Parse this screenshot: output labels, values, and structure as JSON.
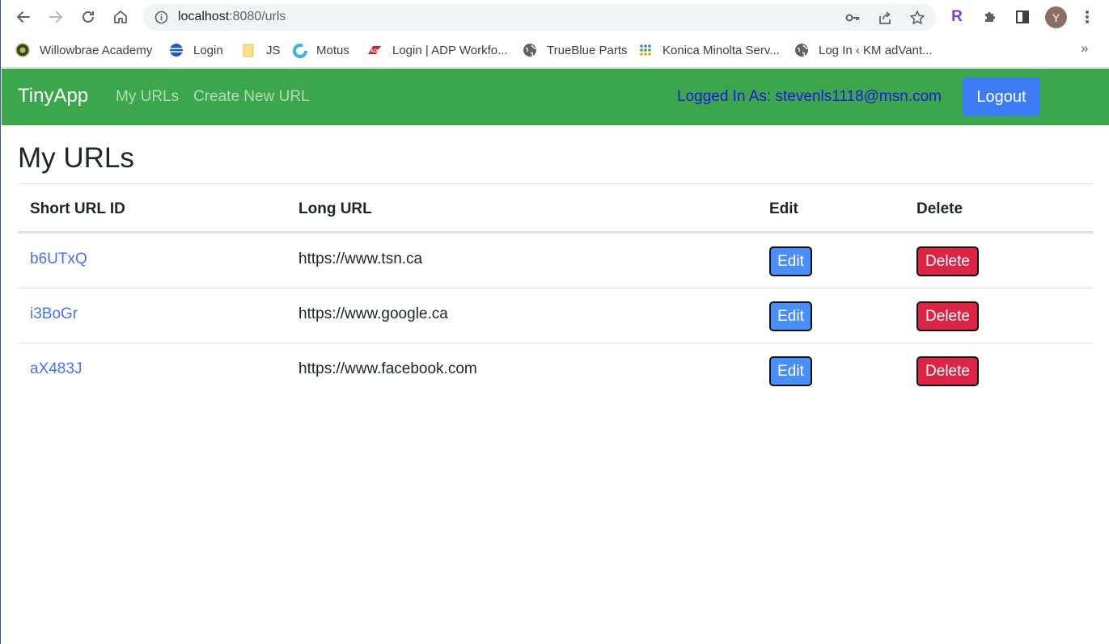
{
  "browser": {
    "url_host": "localhost",
    "url_path": ":8080/urls",
    "avatar_letter": "Y",
    "extension_letter": "R",
    "bookmarks": [
      {
        "label": "Willowbrae Academy",
        "icon": "crest-icon"
      },
      {
        "label": "Login",
        "icon": "globe-blue-icon"
      },
      {
        "label": "JS",
        "icon": "folder-icon"
      },
      {
        "label": "Motus",
        "icon": "motus-ring-icon"
      },
      {
        "label": "Login | ADP Workfo...",
        "icon": "adp-logo-icon"
      },
      {
        "label": "TrueBlue Parts",
        "icon": "globe-icon"
      },
      {
        "label": "Konica Minolta Serv...",
        "icon": "grid-dots-icon"
      },
      {
        "label": "Log In ‹ KM adVant...",
        "icon": "globe-icon"
      }
    ],
    "more": "»"
  },
  "navbar": {
    "brand": "TinyApp",
    "links": [
      "My URLs",
      "Create New URL"
    ],
    "logged_in": "Logged In As: stevenls1118@msn.com",
    "logout_label": "Logout",
    "bg_color": "#3ca64c"
  },
  "main": {
    "title": "My URLs",
    "columns": [
      "Short URL ID",
      "Long URL",
      "Edit",
      "Delete"
    ],
    "rows": [
      {
        "id": "b6UTxQ",
        "long_url": "https://www.tsn.ca",
        "edit": "Edit",
        "delete": "Delete"
      },
      {
        "id": "i3BoGr",
        "long_url": "https://www.google.ca",
        "edit": "Edit",
        "delete": "Delete"
      },
      {
        "id": "aX483J",
        "long_url": "https://www.facebook.com",
        "edit": "Edit",
        "delete": "Delete"
      }
    ]
  }
}
